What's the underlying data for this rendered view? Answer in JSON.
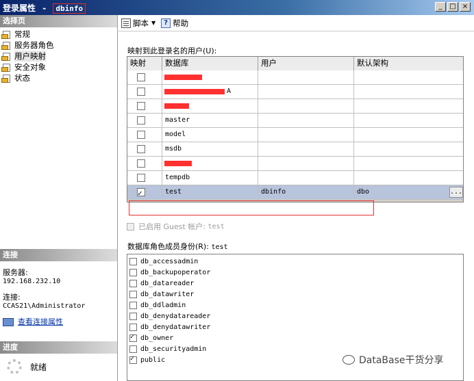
{
  "window": {
    "title": "登录属性",
    "separator": "-",
    "login_name": "dbinfo",
    "btn_min": "_",
    "btn_max": "□",
    "btn_close": "×"
  },
  "left": {
    "select_page_header": "选择页",
    "pages": [
      {
        "label": "常规"
      },
      {
        "label": "服务器角色"
      },
      {
        "label": "用户映射"
      },
      {
        "label": "安全对象"
      },
      {
        "label": "状态"
      }
    ],
    "connection_header": "连接",
    "server_label": "服务器:",
    "server_value": "192.168.232.10",
    "connection_label": "连接:",
    "connection_value": "CCAS21\\Administrator",
    "view_conn_link": "查看连接属性",
    "progress_header": "进度",
    "progress_status": "就绪"
  },
  "toolbar": {
    "script_label": "脚本",
    "help_label": "帮助"
  },
  "mapping": {
    "label": "映射到此登录名的用户(U):",
    "columns": [
      "映射",
      "数据库",
      "用户",
      "默认架构"
    ],
    "rows": [
      {
        "checked": false,
        "db": "",
        "user": "",
        "schema": "",
        "redacted": true
      },
      {
        "checked": false,
        "db": "A",
        "user": "",
        "schema": "",
        "redacted": true
      },
      {
        "checked": false,
        "db": "",
        "user": "",
        "schema": "",
        "redacted": true
      },
      {
        "checked": false,
        "db": "master",
        "user": "",
        "schema": ""
      },
      {
        "checked": false,
        "db": "model",
        "user": "",
        "schema": ""
      },
      {
        "checked": false,
        "db": "msdb",
        "user": "",
        "schema": ""
      },
      {
        "checked": false,
        "db": "",
        "user": "",
        "schema": "",
        "redacted": true
      },
      {
        "checked": false,
        "db": "tempdb",
        "user": "",
        "schema": ""
      },
      {
        "checked": true,
        "db": "test",
        "user": "dbinfo",
        "schema": "dbo",
        "selected": true
      }
    ],
    "ellipsis_label": "..."
  },
  "guest": {
    "label": "已启用 Guest 帐户:",
    "db": "test"
  },
  "roles": {
    "label": "数据库角色成员身份(R):",
    "db": "test",
    "items": [
      {
        "name": "db_accessadmin",
        "checked": false
      },
      {
        "name": "db_backupoperator",
        "checked": false
      },
      {
        "name": "db_datareader",
        "checked": false
      },
      {
        "name": "db_datawriter",
        "checked": false
      },
      {
        "name": "db_ddladmin",
        "checked": false
      },
      {
        "name": "db_denydatareader",
        "checked": false
      },
      {
        "name": "db_denydatawriter",
        "checked": false
      },
      {
        "name": "db_owner",
        "checked": true
      },
      {
        "name": "db_securityadmin",
        "checked": false
      },
      {
        "name": "public",
        "checked": true
      }
    ]
  },
  "watermark": {
    "text": "DataBase干货分享"
  }
}
